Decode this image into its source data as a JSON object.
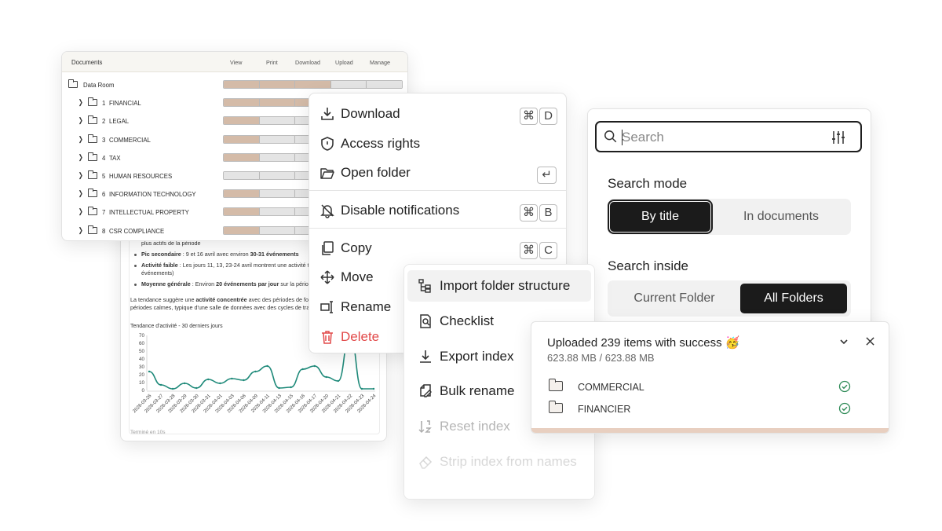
{
  "documents": {
    "header": {
      "title": "Documents",
      "columns": [
        "View",
        "Print",
        "Download",
        "Upload",
        "Manage"
      ]
    },
    "root": {
      "label": "Data Room",
      "level": 3
    },
    "folders": [
      {
        "index": "1",
        "name": "FINANCIAL",
        "level": 3
      },
      {
        "index": "2",
        "name": "LEGAL",
        "level": 1
      },
      {
        "index": "3",
        "name": "COMMERCIAL",
        "level": 1
      },
      {
        "index": "4",
        "name": "TAX",
        "level": 1
      },
      {
        "index": "5",
        "name": "HUMAN RESOURCES",
        "level": 0
      },
      {
        "index": "6",
        "name": "INFORMATION TECHNOLOGY",
        "level": 1
      },
      {
        "index": "7",
        "name": "INTELLECTUAL PROPERTY",
        "level": 1
      },
      {
        "index": "8",
        "name": "CSR COMPLIANCE",
        "level": 1
      }
    ]
  },
  "report": {
    "line_top": "plus actifs de la période",
    "bullets": [
      {
        "bold": "Pic secondaire",
        "rest": " : 9 et 16 avril avec environ ",
        "bold2": "30-31 événements",
        "rest2": ""
      },
      {
        "bold": "Activité faible",
        "rest": " : Les jours 11, 13, 23-24 avril montrent une activité tr",
        "bold2": "",
        "rest2": ""
      },
      {
        "bold": "Moyenne générale",
        "rest": " : Environ ",
        "bold2": "20 événements par jour",
        "rest2": " sur la périod"
      }
    ],
    "bullet_cont": "événements)",
    "para_1a": "La tendance suggère une ",
    "para_1b": "activité concentrée",
    "para_1c": " avec des périodes de for",
    "para_2": "périodes calmes, typique d'une salle de données avec des cycles de tra",
    "footer": "Terminé en 10s"
  },
  "chart_data": {
    "type": "line",
    "title": "Tendance d'activité - 30 derniers jours",
    "xlabel": "",
    "ylabel": "",
    "ylim": [
      0,
      70
    ],
    "yticks": [
      0,
      10,
      20,
      30,
      40,
      50,
      60,
      70
    ],
    "categories": [
      "2026-03-26",
      "2026-03-27",
      "2026-03-28",
      "2026-03-29",
      "2026-03-30",
      "2026-03-31",
      "2026-04-01",
      "2026-04-03",
      "2026-04-06",
      "2026-04-09",
      "2026-04-11",
      "2026-04-13",
      "2026-04-15",
      "2026-04-16",
      "2026-04-17",
      "2026-04-20",
      "2026-04-21",
      "2026-04-22",
      "2026-04-23",
      "2026-04-24"
    ],
    "values": [
      24,
      7,
      2,
      9,
      3,
      14,
      9,
      15,
      13,
      24,
      31,
      3,
      4,
      27,
      31,
      17,
      12,
      72,
      2,
      2
    ],
    "series_color": "#1f8a7a",
    "grid": false
  },
  "context_menu": {
    "items": [
      {
        "label": "Download",
        "icon": "download-icon",
        "keys": [
          "⌘",
          "D"
        ]
      },
      {
        "label": "Access rights",
        "icon": "shield-icon",
        "keys": []
      },
      {
        "label": "Open folder",
        "icon": "folder-open-icon",
        "keys": [
          "↵"
        ]
      },
      {
        "label": "Disable notifications",
        "icon": "bell-off-icon",
        "keys": [
          "⌘",
          "B"
        ]
      },
      {
        "label": "Copy",
        "icon": "copy-icon",
        "keys": [
          "⌘",
          "C"
        ]
      },
      {
        "label": "Move",
        "icon": "move-icon",
        "keys": []
      },
      {
        "label": "Rename",
        "icon": "rename-icon",
        "keys": []
      },
      {
        "label": "Delete",
        "icon": "trash-icon",
        "keys": []
      }
    ]
  },
  "submenu": {
    "items": [
      {
        "label": "Import folder structure",
        "icon": "folder-tree-icon"
      },
      {
        "label": "Checklist",
        "icon": "checklist-icon"
      },
      {
        "label": "Export index",
        "icon": "export-icon"
      },
      {
        "label": "Bulk rename",
        "icon": "bulk-rename-icon"
      },
      {
        "label": "Reset index",
        "icon": "sort-icon"
      },
      {
        "label": "Strip index from names",
        "icon": "eraser-icon"
      }
    ]
  },
  "search": {
    "placeholder": "Search",
    "value": "",
    "mode_label": "Search mode",
    "modes": [
      "By title",
      "In documents"
    ],
    "selected_mode": "By title",
    "inside_label": "Search inside",
    "scopes": [
      "Current Folder",
      "All Folders"
    ],
    "selected_scope": "All Folders"
  },
  "upload": {
    "title": "Uploaded 239 items with success 🥳",
    "size": "623.88 MB / 623.88 MB",
    "items": [
      "COMMERCIAL",
      "FINANCIER"
    ],
    "accent": "#2e8b57"
  }
}
